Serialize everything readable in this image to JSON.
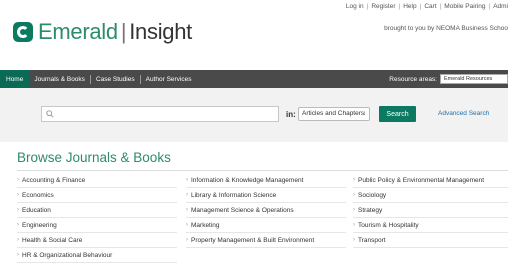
{
  "toplinks": {
    "login": "Log in",
    "register": "Register",
    "help": "Help",
    "cart": "Cart",
    "mobile_pairing": "Mobile Pairing",
    "admin": "Admi"
  },
  "brought": "brought to you by NEOMA Business Schoo",
  "logo": {
    "part1": "Emerald",
    "separator": "|",
    "part2": "Insight"
  },
  "nav": {
    "items": [
      {
        "label": "Home"
      },
      {
        "label": "Journals & Books"
      },
      {
        "label": "Case Studies"
      },
      {
        "label": "Author Services"
      }
    ],
    "resource_label": "Resource areas:",
    "resource_value": "Emerald Resources"
  },
  "search": {
    "placeholder": "",
    "in_label": "in:",
    "scope_value": "Articles and Chapters",
    "button": "Search",
    "advanced": "Advanced Search"
  },
  "browse": {
    "title": "Browse Journals & Books",
    "columns": [
      [
        "Accounting & Finance",
        "Economics",
        "Education",
        "Engineering",
        "Health & Social Care",
        "HR & Organizational Behaviour"
      ],
      [
        "Information & Knowledge Management",
        "Library & Information Science",
        "Management Science & Operations",
        "Marketing",
        "Property Management & Built Environment"
      ],
      [
        "Public Policy & Environmental Management",
        "Sociology",
        "Strategy",
        "Tourism & Hospitality",
        "Transport"
      ]
    ]
  },
  "colors": {
    "brand": "#0b7a61",
    "nav_bg": "#4a4a4a",
    "link": "#1f6fa8"
  }
}
